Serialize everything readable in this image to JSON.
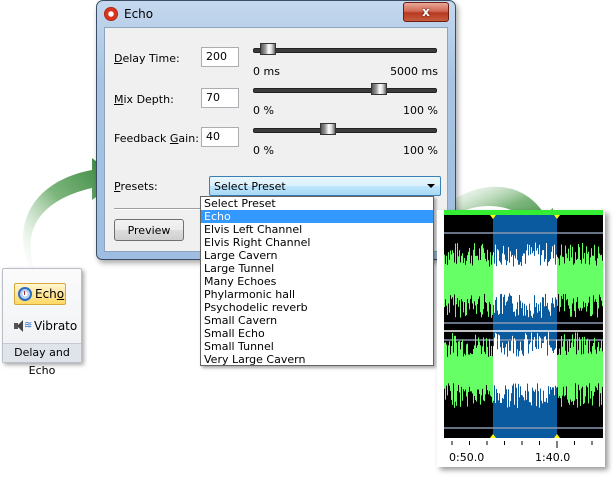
{
  "dialog": {
    "title": "Echo",
    "close_label": "x",
    "controls": [
      {
        "label_pre": "",
        "label_accel": "D",
        "label_post": "elay Time:",
        "value": "200",
        "min_label": "0 ms",
        "max_label": "5000 ms",
        "min": 0,
        "max": 5000,
        "current": 200
      },
      {
        "label_pre": "",
        "label_accel": "M",
        "label_post": "ix Depth:",
        "value": "70",
        "min_label": "0 %",
        "max_label": "100 %",
        "min": 0,
        "max": 100,
        "current": 70
      },
      {
        "label_pre": "Feedback ",
        "label_accel": "G",
        "label_post": "ain:",
        "value": "40",
        "min_label": "0 %",
        "max_label": "100 %",
        "min": 0,
        "max": 100,
        "current": 40
      }
    ],
    "presets": {
      "label_accel": "P",
      "label_post": "resets:",
      "selected": "Select Preset",
      "highlighted": "Echo",
      "options": [
        "Select Preset",
        "Echo",
        "Elvis Left Channel",
        "Elvis Right Channel",
        "Large Cavern",
        "Large Tunnel",
        "Many Echoes",
        "Phylarmonic hall",
        "Psychodelic reverb",
        "Small Cavern",
        "Small Echo",
        "Small Tunnel",
        "Very Large Cavern"
      ]
    },
    "preview_label": "Preview"
  },
  "ribbon": {
    "echo_label_pre": "Ech",
    "echo_label_accel": "o",
    "vibrato_label": "Vibrato",
    "group_label": "Delay and Echo"
  },
  "waveform": {
    "time_labels": [
      "0:50.0",
      "1:40.0"
    ],
    "colors": {
      "wave": "#66ff66",
      "selection": "#0a5aa0",
      "selected_wave": "#ffffff",
      "background": "#000000",
      "marker": "#ffff00"
    }
  }
}
